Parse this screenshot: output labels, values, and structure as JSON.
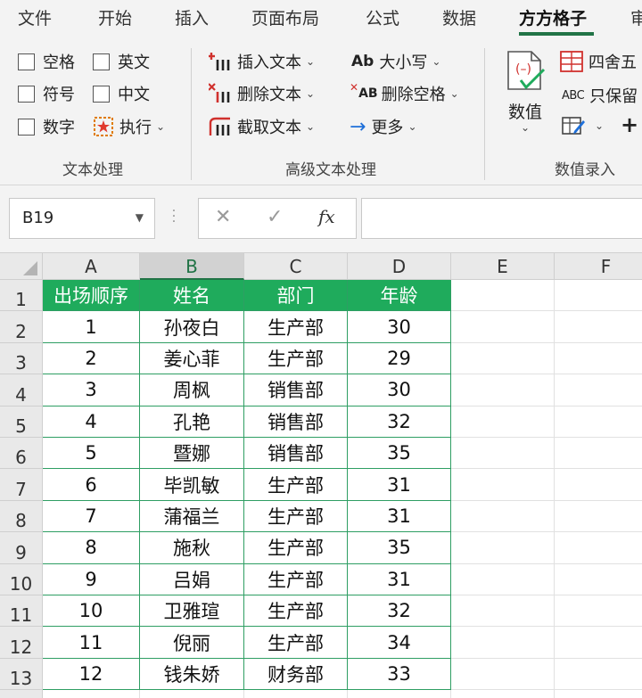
{
  "tabs": [
    {
      "label": "文件",
      "active": false
    },
    {
      "label": "开始",
      "active": false
    },
    {
      "label": "插入",
      "active": false
    },
    {
      "label": "页面布局",
      "active": false
    },
    {
      "label": "公式",
      "active": false
    },
    {
      "label": "数据",
      "active": false
    },
    {
      "label": "方方格子",
      "active": true
    },
    {
      "label": "审",
      "active": false
    }
  ],
  "ribbon": {
    "text_group": {
      "label": "文本处理",
      "items": [
        "空格",
        "英文",
        "符号",
        "中文",
        "数字"
      ],
      "execute": "执行"
    },
    "advanced_group": {
      "label": "高级文本处理",
      "insert_text": "插入文本",
      "delete_text": "删除文本",
      "extract_text": "截取文本",
      "case": "大小写",
      "case_icon": "Ab",
      "delete_space": "删除空格",
      "delete_space_icon": "AB",
      "more": "更多"
    },
    "number_group": {
      "label": "数值录入",
      "value_button": "数值",
      "round": "四舍五",
      "keep_only": "只保留",
      "keep_only_icon": "ABC"
    }
  },
  "formula_bar": {
    "name_box": "B19",
    "fx_label": "fx",
    "formula": ""
  },
  "grid": {
    "columns": [
      "A",
      "B",
      "C",
      "D",
      "E",
      "F"
    ],
    "selected_column": "B",
    "row_numbers": [
      "1",
      "2",
      "3",
      "4",
      "5",
      "6",
      "7",
      "8",
      "9",
      "10",
      "11",
      "12",
      "13"
    ],
    "header": [
      "出场顺序",
      "姓名",
      "部门",
      "年龄"
    ],
    "rows": [
      [
        "1",
        "孙夜白",
        "生产部",
        "30"
      ],
      [
        "2",
        "姜心菲",
        "生产部",
        "29"
      ],
      [
        "3",
        "周枫",
        "销售部",
        "30"
      ],
      [
        "4",
        "孔艳",
        "销售部",
        "32"
      ],
      [
        "5",
        "暨娜",
        "销售部",
        "35"
      ],
      [
        "6",
        "毕凯敏",
        "生产部",
        "31"
      ],
      [
        "7",
        "蒲福兰",
        "生产部",
        "31"
      ],
      [
        "8",
        "施秋",
        "生产部",
        "35"
      ],
      [
        "9",
        "吕娟",
        "生产部",
        "31"
      ],
      [
        "10",
        "卫雅瑄",
        "生产部",
        "32"
      ],
      [
        "11",
        "倪丽",
        "生产部",
        "34"
      ],
      [
        "12",
        "钱朱娇",
        "财务部",
        "33"
      ]
    ]
  },
  "colors": {
    "accent": "#217346",
    "header_fill": "#1fab5c",
    "table_border": "#2e9e63",
    "icon_red": "#c0392b",
    "icon_blue": "#1e6fd9"
  }
}
